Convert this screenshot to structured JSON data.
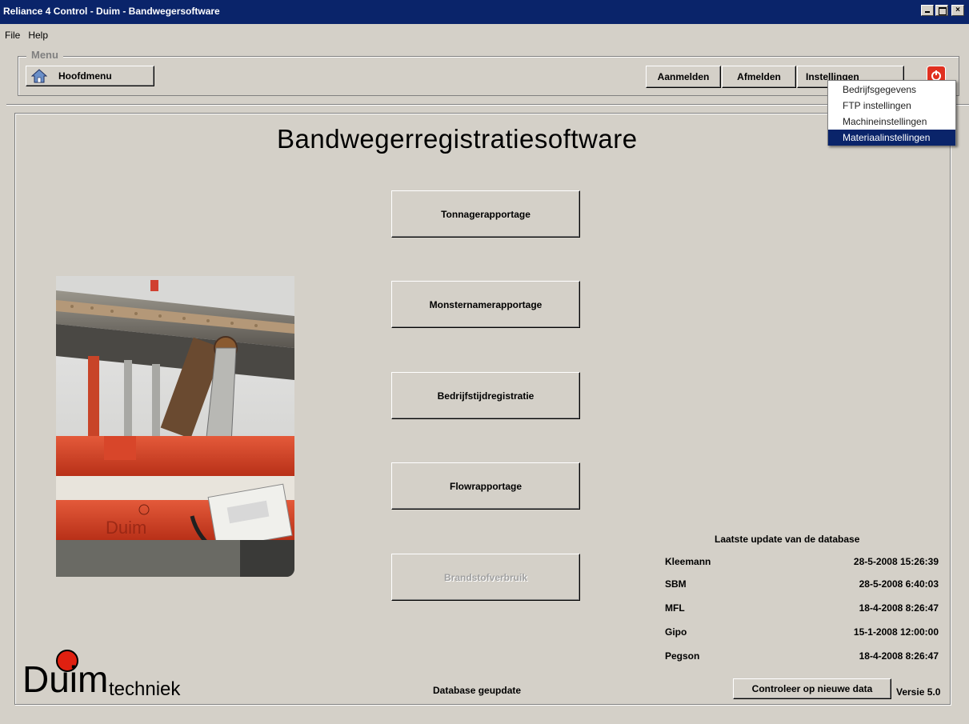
{
  "window": {
    "title": "Reliance 4 Control - Duim - Bandwegersoftware"
  },
  "menubar": {
    "items": [
      "File",
      "Help"
    ]
  },
  "menu_group": {
    "legend": "Menu",
    "home_label": "Hoofdmenu",
    "login_label": "Aanmelden",
    "logout_label": "Afmelden",
    "settings_label": "Instellingen"
  },
  "settings_dropdown": {
    "items": [
      "Bedrijfsgegevens",
      "FTP instellingen",
      "Machineinstellingen",
      "Materiaalinstellingen"
    ],
    "selected": "Materiaalinstellingen"
  },
  "main": {
    "title": "Bandwegerregistratiesoftware",
    "buttons": [
      {
        "label": "Tonnagerapportage",
        "enabled": true
      },
      {
        "label": "Monsternamerapportage",
        "enabled": true
      },
      {
        "label": "Bedrijfstijdregistratie",
        "enabled": true
      },
      {
        "label": "Flowrapportage",
        "enabled": true
      },
      {
        "label": "Brandstofverbruik",
        "enabled": false
      }
    ]
  },
  "database": {
    "heading": "Laatste update van de database",
    "rows": [
      {
        "name": "Kleemann",
        "time": "28-5-2008 15:26:39"
      },
      {
        "name": "SBM",
        "time": "28-5-2008 6:40:03"
      },
      {
        "name": "MFL",
        "time": "18-4-2008 8:26:47"
      },
      {
        "name": "Gipo",
        "time": "15-1-2008 12:00:00"
      },
      {
        "name": "Pegson",
        "time": "18-4-2008 8:26:47"
      }
    ]
  },
  "footer": {
    "status": "Database geupdate",
    "check_label": "Controleer op nieuwe data",
    "version": "Versie 5.0"
  },
  "logo": {
    "name": "Duim",
    "subtitle": "techniek"
  },
  "photo": {
    "caption_text": "Duim"
  },
  "colors": {
    "titlebar": "#0a246a",
    "background": "#d4d0c8",
    "selection": "#0a246a",
    "power": "#e03020",
    "conveyor_red": "#d8462a"
  }
}
